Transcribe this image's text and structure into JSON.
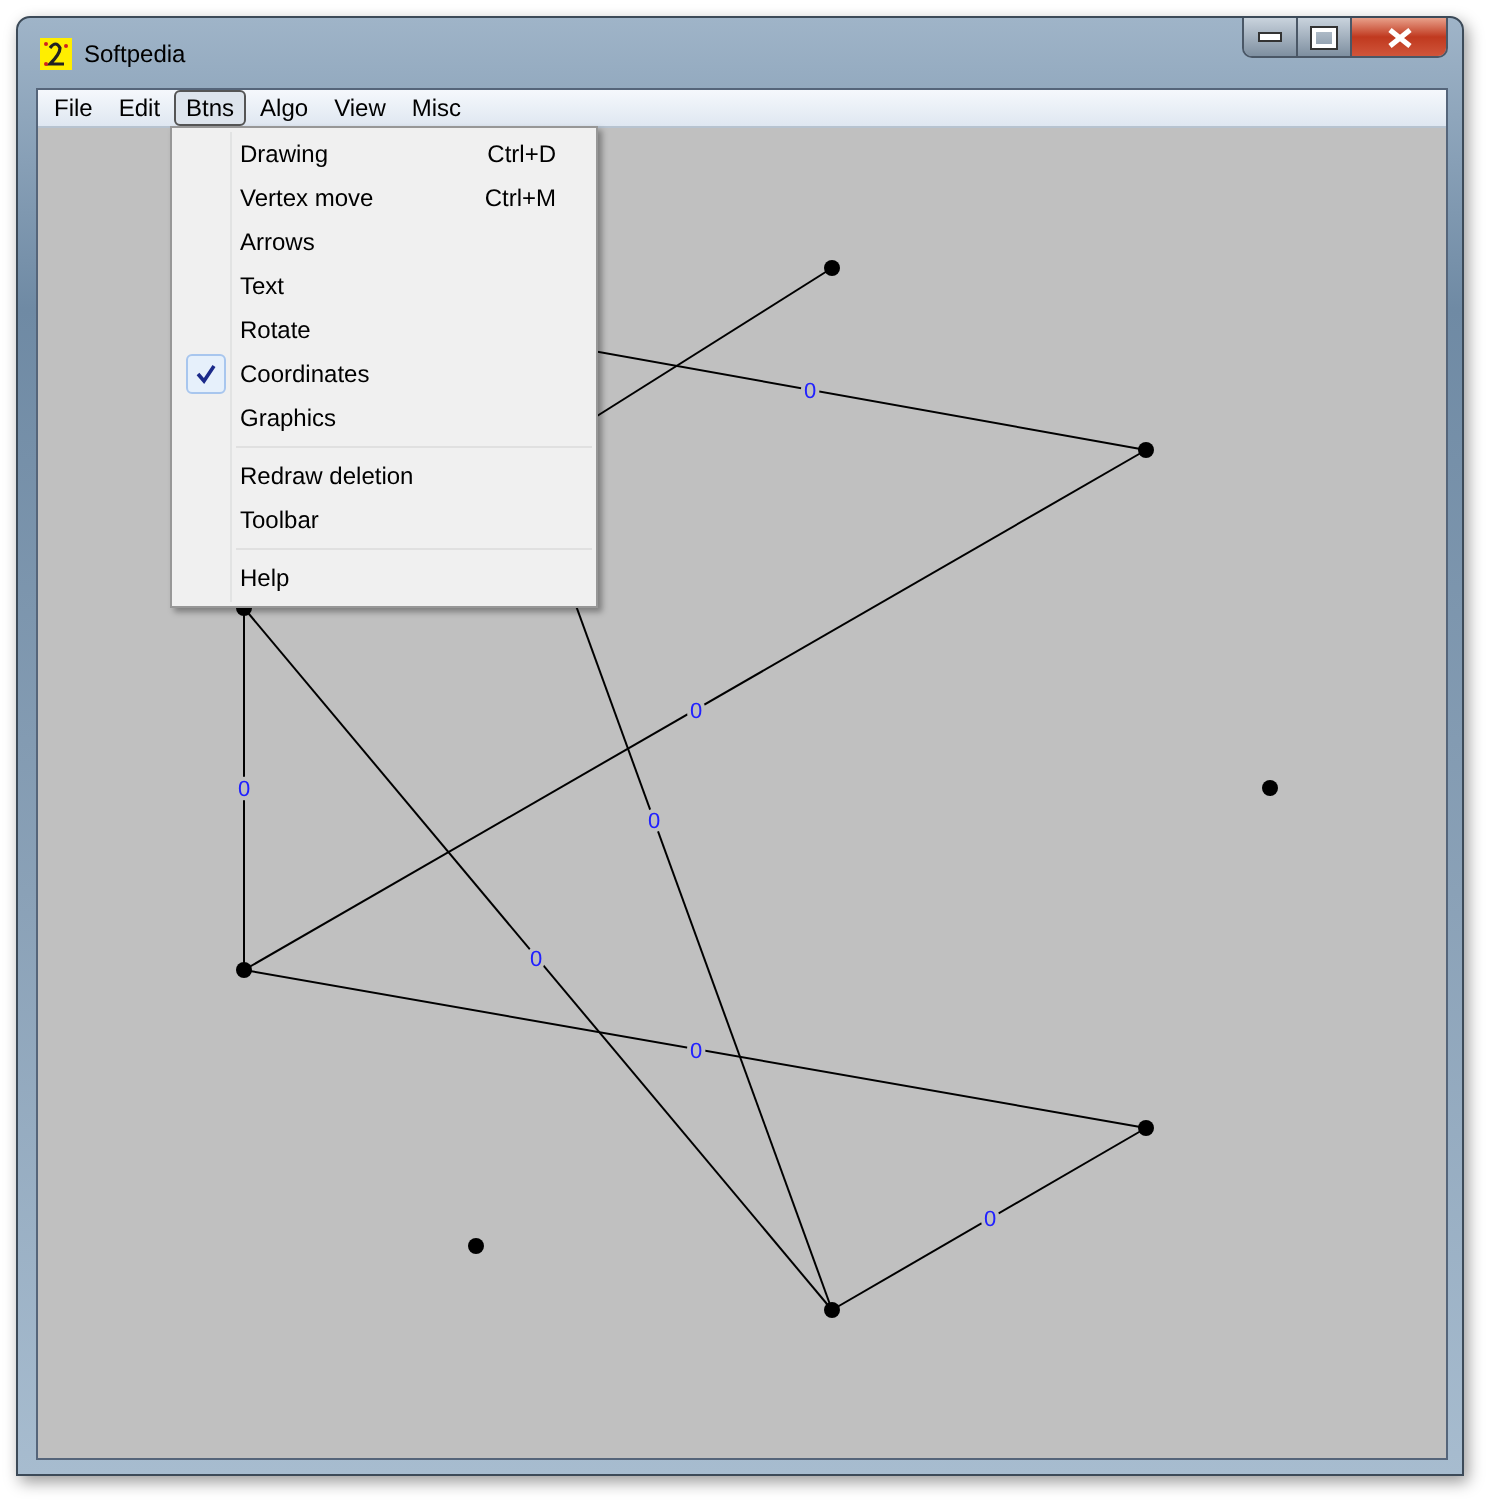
{
  "window": {
    "title": "Softpedia"
  },
  "menubar": [
    {
      "label": "File",
      "selected": false
    },
    {
      "label": "Edit",
      "selected": false
    },
    {
      "label": "Btns",
      "selected": true
    },
    {
      "label": "Algo",
      "selected": false
    },
    {
      "label": "View",
      "selected": false
    },
    {
      "label": "Misc",
      "selected": false
    }
  ],
  "menu": [
    {
      "kind": "item",
      "label": "Drawing",
      "shortcut": "Ctrl+D",
      "checked": false
    },
    {
      "kind": "item",
      "label": "Vertex move",
      "shortcut": "Ctrl+M",
      "checked": false
    },
    {
      "kind": "item",
      "label": "Arrows",
      "checked": false
    },
    {
      "kind": "item",
      "label": "Text",
      "checked": false
    },
    {
      "kind": "item",
      "label": "Rotate",
      "checked": false
    },
    {
      "kind": "item",
      "label": "Coordinates",
      "checked": true
    },
    {
      "kind": "item",
      "label": "Graphics",
      "checked": false
    },
    {
      "kind": "separator"
    },
    {
      "kind": "item",
      "label": "Redraw deletion",
      "checked": false
    },
    {
      "kind": "item",
      "label": "Toolbar",
      "checked": false
    },
    {
      "kind": "separator"
    },
    {
      "kind": "item",
      "label": "Help",
      "checked": false
    }
  ],
  "graph": {
    "edges": [
      {
        "label": "0"
      },
      {
        "label": "0"
      },
      {
        "label": "0"
      },
      {
        "label": "0"
      },
      {
        "label": "0"
      },
      {
        "label": "0"
      },
      {
        "label": "0"
      }
    ]
  }
}
